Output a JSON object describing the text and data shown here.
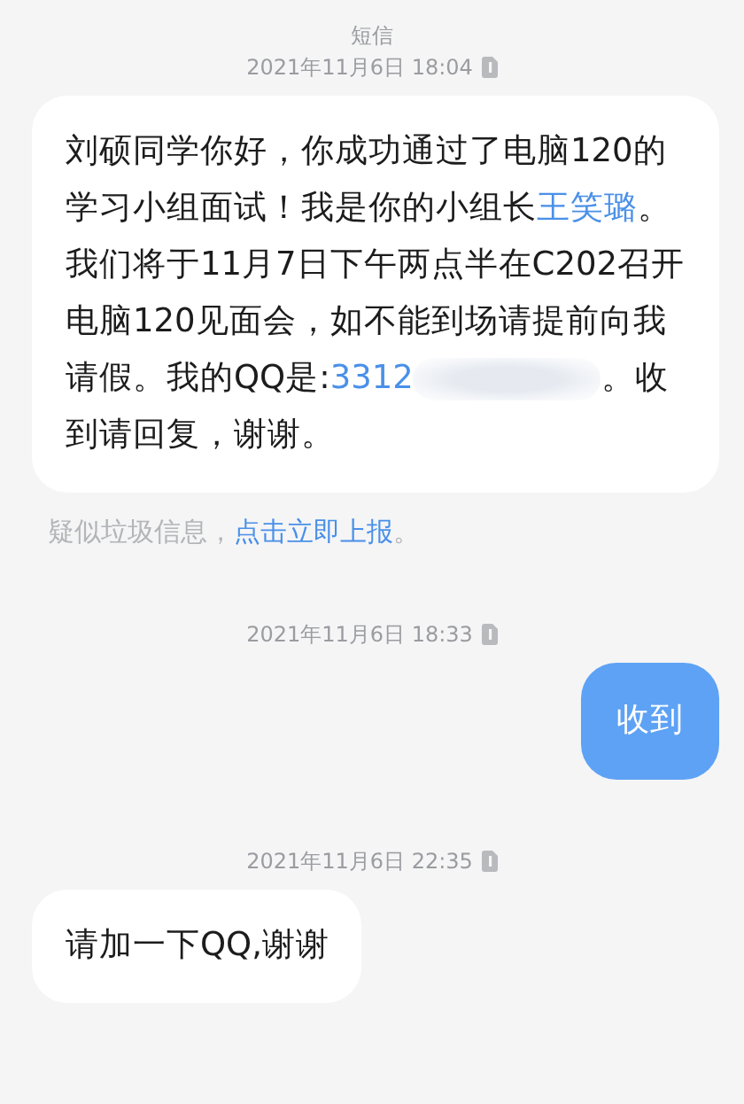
{
  "header": {
    "title": "短信"
  },
  "items": [
    {
      "kind": "timestamp",
      "text": "2021年11月6日 18:04"
    },
    {
      "kind": "received",
      "segments": [
        {
          "kind": "text",
          "text": "刘硕同学你好，你成功通过了电脑120的学习小组面试！我是你的小组长"
        },
        {
          "kind": "link",
          "text": "王笑璐"
        },
        {
          "kind": "text",
          "text": "。我们将于11月7日下午两点半在C202召开电脑120见面会，如不能到场请提前向我请假。我的QQ是:"
        },
        {
          "kind": "link",
          "text": "3312"
        },
        {
          "kind": "redacted"
        },
        {
          "kind": "text",
          "text": "。收到请回复，谢谢。"
        }
      ]
    },
    {
      "kind": "notice",
      "segments": [
        {
          "kind": "text",
          "text": "疑似垃圾信息，"
        },
        {
          "kind": "link",
          "text": "点击立即上报"
        },
        {
          "kind": "text",
          "text": "。"
        }
      ]
    },
    {
      "kind": "timestamp",
      "text": "2021年11月6日 18:33"
    },
    {
      "kind": "sent",
      "segments": [
        {
          "kind": "text",
          "text": "收到"
        }
      ]
    },
    {
      "kind": "timestamp",
      "text": "2021年11月6日 22:35"
    },
    {
      "kind": "received",
      "segments": [
        {
          "kind": "text",
          "text": "请加一下QQ,谢谢"
        }
      ]
    }
  ]
}
